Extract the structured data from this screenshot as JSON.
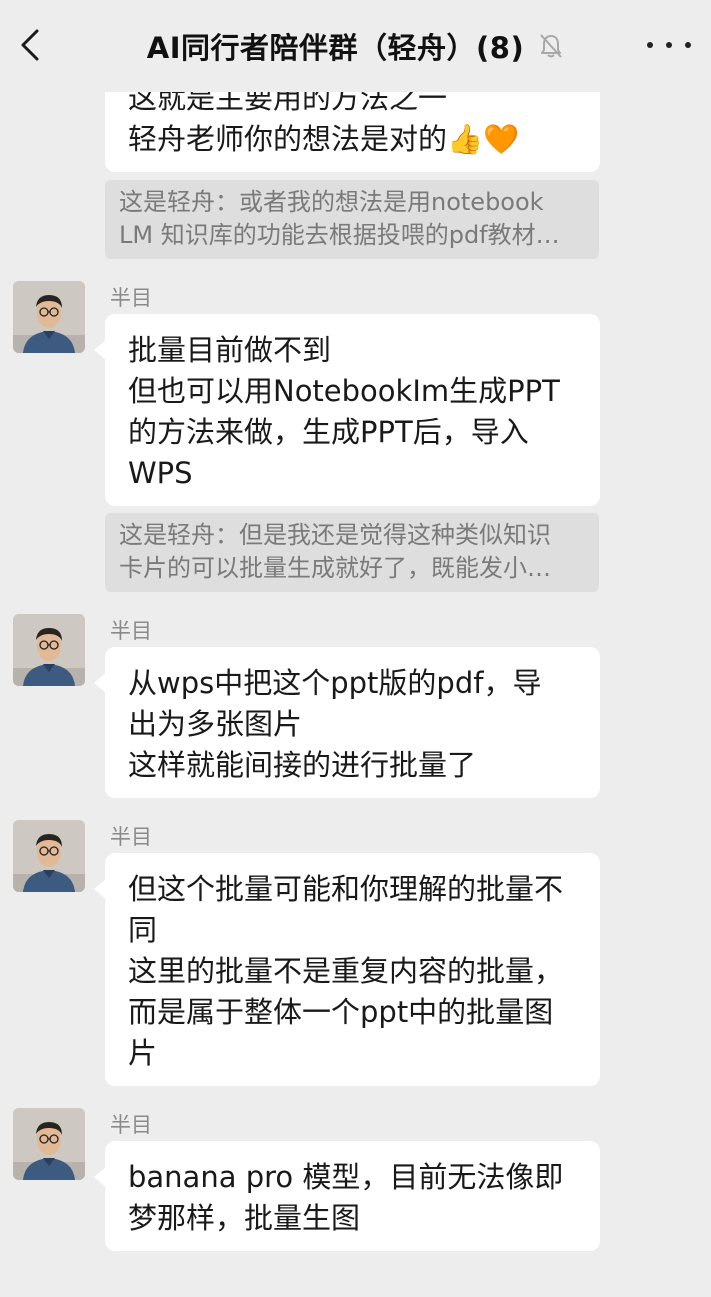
{
  "header": {
    "title": "AI同行者陪伴群（轻舟）(8)",
    "back_icon": "chevron-left-icon",
    "mute_icon": "bell-off-icon",
    "more_icon": "more-dots-icon"
  },
  "messages": [
    {
      "text": "这就是主要用的方法之一\n轻舟老师你的想法是对的👍🧡",
      "quote": "这是轻舟：或者我的想法是用notebook\nLM 知识库的功能去根据投喂的pdf教材…"
    },
    {
      "sender": "半目",
      "text": "批量目前做不到\n但也可以用NotebookIm生成PPT\n的方法来做，生成PPT后，导入\nWPS",
      "quote": "这是轻舟：但是我还是觉得这种类似知识\n卡片的可以批量生成就好了，既能发小…"
    },
    {
      "sender": "半目",
      "text": "从wps中把这个ppt版的pdf，导\n出为多张图片\n这样就能间接的进行批量了"
    },
    {
      "sender": "半目",
      "text": "但这个批量可能和你理解的批量不\n同\n这里的批量不是重复内容的批量，\n而是属于整体一个ppt中的批量图\n片"
    },
    {
      "sender": "半目",
      "text": "banana pro 模型，目前无法像即\n梦那样，批量生图"
    }
  ],
  "colors": {
    "background": "#ededed",
    "bubble": "#ffffff",
    "quote_bg": "#dedede",
    "quote_text": "#7a7a7a",
    "sender_text": "#8a8a8a"
  }
}
